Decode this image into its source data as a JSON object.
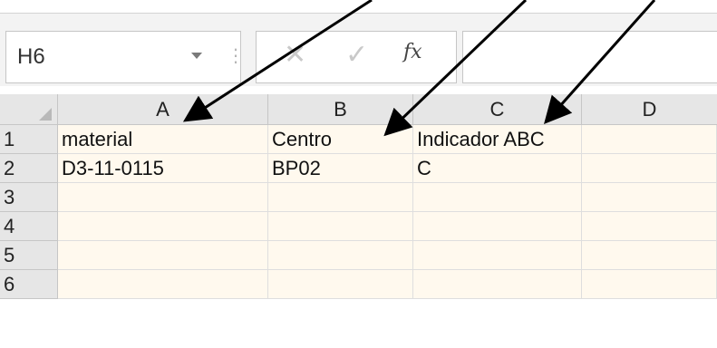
{
  "formula_bar": {
    "name_box": "H6",
    "cancel_icon": "cancel-x-icon",
    "enter_icon": "enter-check-icon",
    "fx_label": "fx",
    "formula_value": ""
  },
  "sheet": {
    "columns": [
      "A",
      "B",
      "C",
      "D"
    ],
    "rows": [
      {
        "num": "1",
        "cells": [
          "material",
          "Centro",
          "Indicador ABC",
          ""
        ]
      },
      {
        "num": "2",
        "cells": [
          "D3-11-0115",
          "BP02",
          "C",
          ""
        ]
      },
      {
        "num": "3",
        "cells": [
          "",
          "",
          "",
          ""
        ]
      },
      {
        "num": "4",
        "cells": [
          "",
          "",
          "",
          ""
        ]
      },
      {
        "num": "5",
        "cells": [
          "",
          "",
          "",
          ""
        ]
      },
      {
        "num": "6",
        "cells": [
          "",
          "",
          "",
          ""
        ]
      }
    ]
  },
  "colors": {
    "cell_bg": "#fff9ee",
    "header_bg": "#e6e6e6",
    "arrow": "#000000"
  }
}
